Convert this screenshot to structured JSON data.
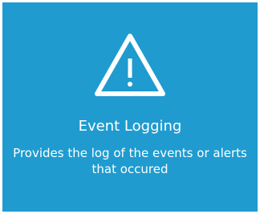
{
  "tile": {
    "icon": "warning-triangle-icon",
    "title": "Event Logging",
    "description": "Provides the log of the events or alerts that occured"
  },
  "colors": {
    "tile_background": "#1f9bcf",
    "foreground": "#ffffff"
  }
}
